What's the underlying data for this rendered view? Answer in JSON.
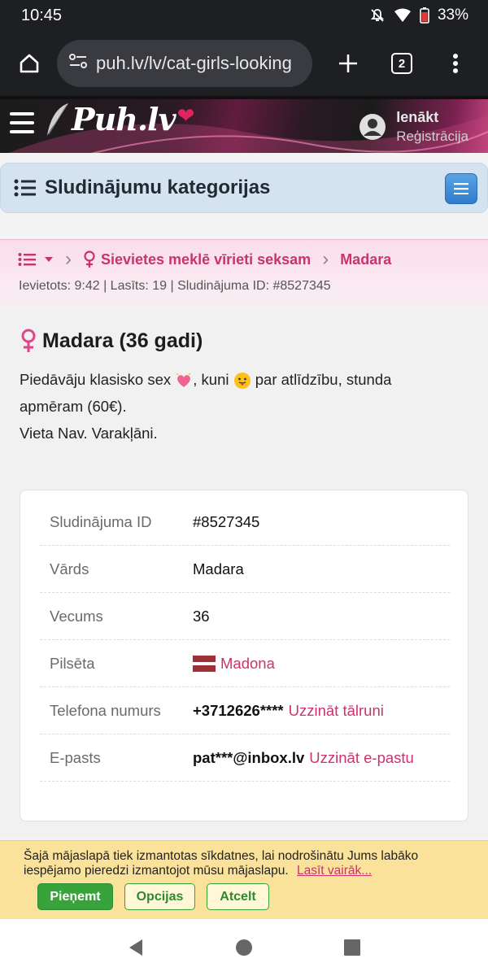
{
  "status_bar": {
    "time": "10:45",
    "battery": "33%"
  },
  "browser": {
    "url": "puh.lv/lv/cat-girls-looking",
    "tab_count": "2"
  },
  "header": {
    "logo": "Puh.lv",
    "login": "Ienākt",
    "register": "Reģistrācija"
  },
  "category_bar": {
    "title": "Sludinājumu kategorijas"
  },
  "breadcrumb": {
    "category": "Sievietes meklē vīrieti seksam",
    "current": "Madara",
    "meta": "Ievietots: 9:42 | Lasīts: 19 | Sludinājuma ID: #8527345"
  },
  "ad": {
    "title": "Madara (36 gadi)",
    "desc_part1": "Piedāvāju klasisko sex",
    "desc_part2": ", kuni",
    "desc_part3": "par atlīdzību, stunda apmēram (60€).",
    "location_line": "Vieta Nav. Varakļāni."
  },
  "details": {
    "rows": [
      {
        "label": "Sludinājuma ID",
        "value": "#8527345"
      },
      {
        "label": "Vārds",
        "value": "Madara"
      },
      {
        "label": "Vecums",
        "value": "36"
      },
      {
        "label": "Pilsēta",
        "value": "Madona"
      },
      {
        "label": "Telefona numurs",
        "value": "+3712626****",
        "link": "Uzzināt tālruni"
      },
      {
        "label": "E-pasts",
        "value": "pat***@inbox.lv",
        "link": "Uzzināt e-pastu"
      }
    ]
  },
  "cookie": {
    "text": "Šajā mājaslapā tiek izmantotas sīkdatnes, lai nodrošinātu Jums labāko iespējamo pieredzi izmantojot mūsu mājaslapu.",
    "read_more": "Lasīt vairāk...",
    "accept": "Pieņemt",
    "options": "Opcijas",
    "reject": "Atcelt"
  },
  "colors": {
    "brand_pink": "#c9336e",
    "accept_green": "#37a33a",
    "cookie_bg": "#fbe29a"
  },
  "icons": [
    "mute-icon",
    "wifi-icon",
    "battery-icon",
    "home-icon",
    "site-settings-icon",
    "new-tab-icon",
    "menu-dots-icon",
    "hamburger-icon",
    "user-icon",
    "list-icon",
    "venus-icon",
    "latvia-flag-icon",
    "back-icon",
    "home-circle-icon",
    "recents-icon"
  ]
}
